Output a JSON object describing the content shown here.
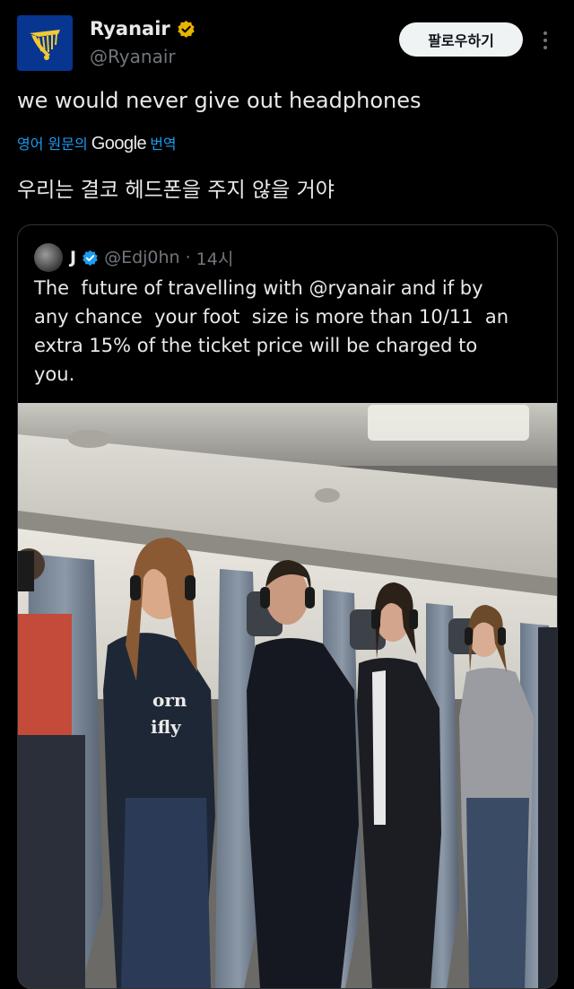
{
  "author": {
    "name": "Ryanair",
    "handle": "@Ryanair",
    "follow_label": "팔로우하기",
    "more_icon": "more-vertical-icon",
    "verified_color": "#e8b500"
  },
  "tweet": {
    "text": "we would never give out headphones",
    "translate_prefix": "영어 원문의",
    "translate_brand": "Google",
    "translate_suffix": "번역",
    "translated_text": "우리는 결코 헤드폰을 주지 않을 거야"
  },
  "quote": {
    "name": "J",
    "handle": "@Edj0hn",
    "separator": "·",
    "time": "14시",
    "text": "The  future of travelling with @ryanair and if by\nany chance  your foot  size is more than 10/11  an\nextra 15% of the ticket price will be charged to\nyou.",
    "verified_color": "#1d9bf0"
  },
  "image": {
    "shirt_text_line1": "orn",
    "shirt_text_line2": "ifly"
  },
  "colors": {
    "background": "#000000",
    "text": "#e7e9ea",
    "muted": "#71767b",
    "link": "#1d9bf0"
  }
}
